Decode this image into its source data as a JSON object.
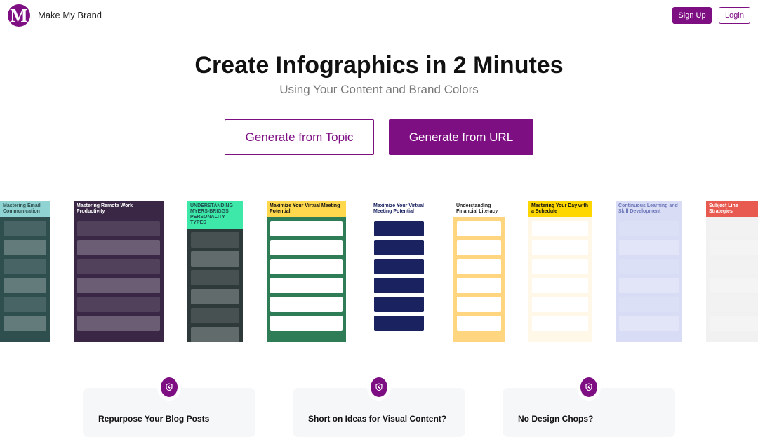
{
  "header": {
    "logo_letter": "M",
    "brand": "Make My Brand",
    "signup": "Sign Up",
    "login": "Login"
  },
  "hero": {
    "title": "Create Infographics in 2 Minutes",
    "subtitle": "Using Your Content and Brand Colors",
    "topic_button": "Generate from Topic",
    "url_button": "Generate from URL"
  },
  "colors": {
    "brand": "#7e0f83"
  },
  "gallery": [
    {
      "title": "Mastering Email Communication",
      "bg": "#2f4f4f",
      "head": "#8fd3d3",
      "fg": "#2f4f4f"
    },
    {
      "title": "Mastering Remote Work Productivity",
      "bg": "#3a2745",
      "head": "#3a2745",
      "fg": "#fff"
    },
    {
      "title": "UNDERSTANDING MYERS-BRIGGS PERSONALITY TYPES",
      "bg": "#2e3a3a",
      "head": "#3de8a8",
      "fg": "#1f4f4f"
    },
    {
      "title": "Maximize Your Virtual Meeting Potential",
      "bg": "#2e7d57",
      "head": "#ffd84d",
      "fg": "#111"
    },
    {
      "title": "Maximize Your Virtual Meeting Potential",
      "bg": "#ffffff",
      "head": "#ffffff",
      "fg": "#1a2360"
    },
    {
      "title": "Understanding Financial Literacy",
      "bg": "#ffd580",
      "head": "#ffffff",
      "fg": "#222"
    },
    {
      "title": "Mastering Your Day with a Schedule",
      "bg": "#fff8e8",
      "head": "#ffd700",
      "fg": "#111"
    },
    {
      "title": "Continuous Learning and Skill Development",
      "bg": "#d8dcf5",
      "head": "#d8dcf5",
      "fg": "#6a75b8"
    },
    {
      "title": "Subject Line Strategies",
      "bg": "#f1f1f1",
      "head": "#e85a4f",
      "fg": "#fff"
    }
  ],
  "features": [
    {
      "title": "Repurpose Your Blog Posts"
    },
    {
      "title": "Short on Ideas for Visual Content?"
    },
    {
      "title": "No Design Chops?"
    }
  ]
}
